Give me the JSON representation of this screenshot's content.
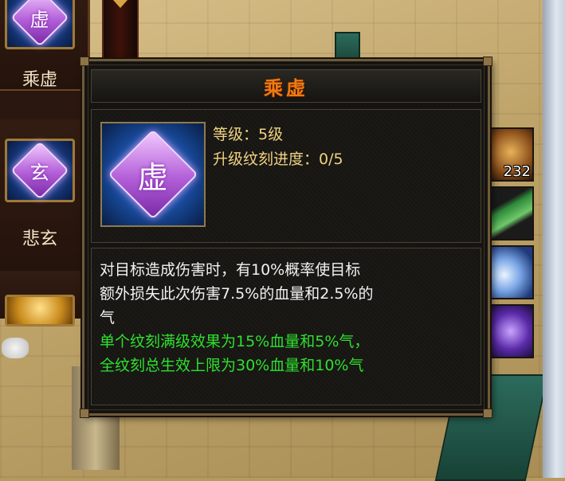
{
  "skill_list": {
    "items": [
      {
        "name": "乘虚",
        "glyph": "虚"
      },
      {
        "name": "悲玄",
        "glyph": "玄"
      },
      {
        "name": "",
        "glyph": ""
      }
    ]
  },
  "tooltip": {
    "title": "乘虚",
    "icon_glyph": "虚",
    "level_label": "等级：5级",
    "progress_label": "升级纹刻进度：0/5",
    "description_lines": [
      "对目标造成伤害时，有10%概率使目标",
      "额外损失此次伤害7.5%的血量和2.5%的",
      "气"
    ],
    "effect_lines": [
      "单个纹刻满级效果为15%血量和5%气，",
      "全纹刻总生效上限为30%血量和10%气"
    ]
  },
  "item_bar": {
    "slots": [
      {
        "icon": "food-item-icon",
        "count": "232"
      },
      {
        "icon": "scroll-item-icon",
        "count": ""
      },
      {
        "icon": "moon-skill-icon",
        "count": ""
      },
      {
        "icon": "creature-skill-icon",
        "count": ""
      }
    ]
  },
  "colors": {
    "title": "#ef7a12",
    "stats": "#f0d280",
    "desc": "#f2f2f2",
    "effect": "#2ee02e"
  }
}
